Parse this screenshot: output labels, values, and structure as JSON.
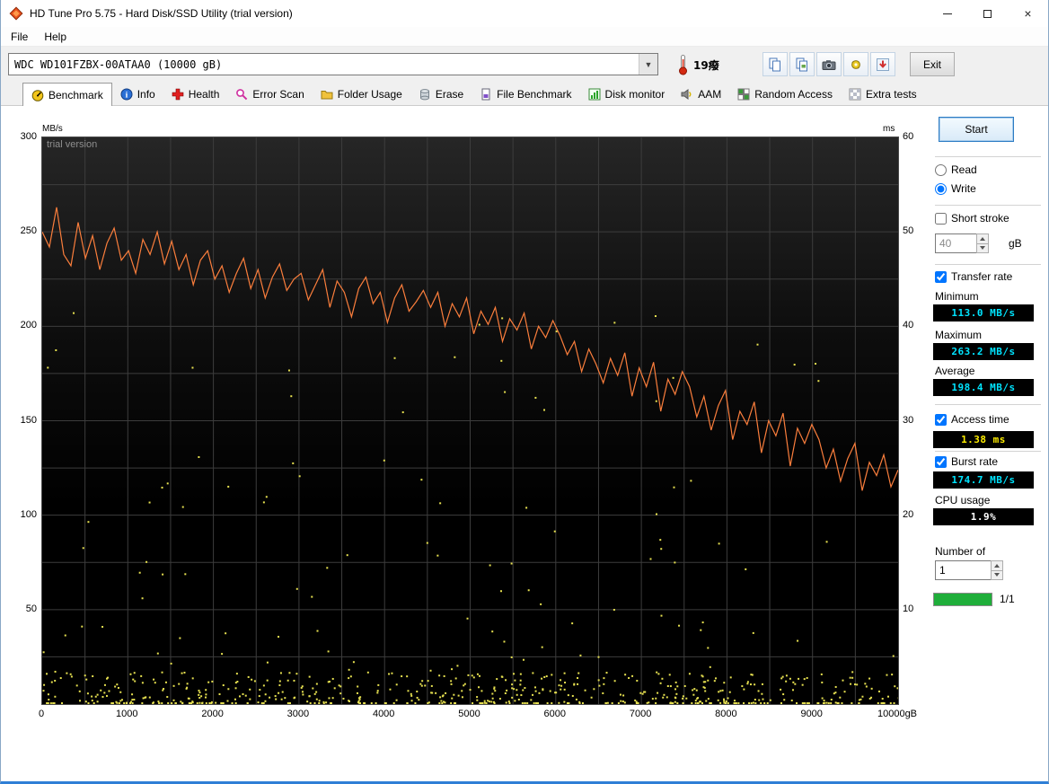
{
  "window": {
    "title": "HD Tune Pro 5.75 - Hard Disk/SSD Utility (trial version)"
  },
  "menu": {
    "items": [
      "File",
      "Help"
    ]
  },
  "toolbar": {
    "drive": "WDC WD101FZBX-00ATAA0 (10000 gB)",
    "temperature": "19癈",
    "exit": "Exit"
  },
  "tabs": {
    "active": "Benchmark",
    "items": [
      {
        "label": "Benchmark"
      },
      {
        "label": "Info"
      },
      {
        "label": "Health"
      },
      {
        "label": "Error Scan"
      },
      {
        "label": "Folder Usage"
      },
      {
        "label": "Erase"
      },
      {
        "label": "File Benchmark"
      },
      {
        "label": "Disk monitor"
      },
      {
        "label": "AAM"
      },
      {
        "label": "Random Access"
      },
      {
        "label": "Extra tests"
      }
    ]
  },
  "chart_data": {
    "type": "line",
    "watermark": "trial version",
    "x_unit": "gB",
    "x_range": [
      0,
      10000
    ],
    "x_tick_step": 1000,
    "x_tick_labels": [
      "0",
      "1000",
      "2000",
      "3000",
      "4000",
      "5000",
      "6000",
      "7000",
      "8000",
      "9000",
      "10000gB"
    ],
    "left_y": {
      "label": "MB/s",
      "range": [
        0,
        300
      ],
      "ticks": [
        50,
        100,
        150,
        200,
        250,
        300
      ]
    },
    "right_y": {
      "label": "ms",
      "range": [
        0,
        60
      ],
      "ticks": [
        10,
        20,
        30,
        40,
        50,
        60
      ]
    },
    "grid": {
      "x_step": 500,
      "y_step": 25,
      "color": "#3d3d3d"
    },
    "series": [
      {
        "name": "Transfer rate",
        "color": "#fb7e3c",
        "values": [
          250,
          242,
          263,
          238,
          232,
          255,
          236,
          248,
          230,
          244,
          252,
          235,
          240,
          228,
          246,
          238,
          250,
          233,
          245,
          230,
          238,
          222,
          235,
          240,
          225,
          232,
          218,
          228,
          236,
          220,
          230,
          215,
          226,
          233,
          219,
          225,
          228,
          214,
          222,
          230,
          210,
          224,
          218,
          205,
          220,
          226,
          212,
          218,
          202,
          215,
          222,
          208,
          213,
          219,
          210,
          218,
          200,
          212,
          205,
          215,
          196,
          208,
          201,
          210,
          192,
          204,
          198,
          207,
          188,
          200,
          194,
          203,
          195,
          185,
          192,
          176,
          188,
          180,
          170,
          183,
          174,
          186,
          163,
          178,
          168,
          181,
          155,
          172,
          164,
          176,
          168,
          152,
          163,
          145,
          158,
          166,
          140,
          155,
          148,
          160,
          133,
          150,
          142,
          154,
          126,
          146,
          138,
          148,
          140,
          125,
          135,
          118,
          130,
          138,
          113,
          128,
          121,
          132,
          115,
          124
        ]
      }
    ],
    "access_dots": {
      "color": "#e6e050",
      "size": 2,
      "seed": 7,
      "band_count": 560,
      "band_max_ms": 3.5,
      "scatter_count": 150,
      "scatter_min_ms": 2,
      "scatter_max_ms": 42
    }
  },
  "controls": {
    "start": "Start",
    "read": "Read",
    "write": "Write",
    "read_checked": false,
    "write_checked": true,
    "short_stroke": "Short stroke",
    "short_stroke_checked": false,
    "short_stroke_value": "40",
    "short_stroke_unit": "gB",
    "transfer_rate": "Transfer rate",
    "transfer_rate_checked": true,
    "minimum_label": "Minimum",
    "minimum_value": "113.0 MB/s",
    "maximum_label": "Maximum",
    "maximum_value": "263.2 MB/s",
    "average_label": "Average",
    "average_value": "198.4 MB/s",
    "access_time": "Access time",
    "access_time_checked": true,
    "access_time_value": "1.38 ms",
    "burst_rate": "Burst rate",
    "burst_rate_checked": true,
    "burst_rate_value": "174.7 MB/s",
    "cpu_usage_label": "CPU usage",
    "cpu_usage_value": "1.9%",
    "number_of_label": "Number of",
    "number_of_value": "1",
    "progress_label": "1/1",
    "progress_color": "#1fae3a"
  }
}
